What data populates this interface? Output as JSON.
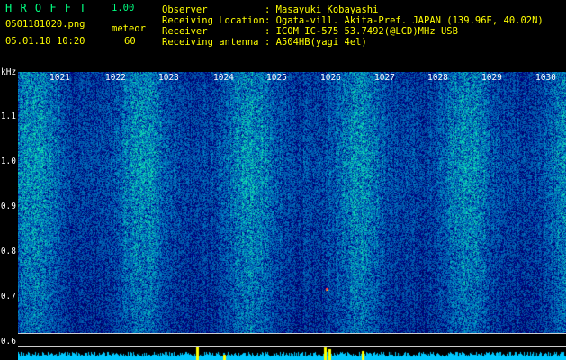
{
  "app": {
    "title_letters": "H R O F F T",
    "version": "1.00",
    "file_name": "0501181020.png",
    "mode": "meteor",
    "datetime": "05.01.18 10:20",
    "count": "60"
  },
  "info": {
    "observer_label": "Observer",
    "observer_value": ": Masayuki Kobayashi",
    "location_label": "Receiving Location",
    "location_value": ": Ogata-vill. Akita-Pref. JAPAN (139.96E, 40.02N)",
    "receiver_label": "Receiver",
    "receiver_value": ": ICOM IC-575 53.7492(@LCD)MHz USB",
    "antenna_label": "Receiving antenna",
    "antenna_value": ": A504HB(yagi 4el)"
  },
  "axis": {
    "unit": "kHz",
    "y_ticks": [
      "1.1",
      "1.0",
      "0.9",
      "0.8",
      "0.7",
      "0.6"
    ],
    "x_ticks": [
      "1021",
      "1022",
      "1023",
      "1024",
      "1025",
      "1026",
      "1027",
      "1028",
      "1029",
      "1030"
    ]
  },
  "colors": {
    "background": "#000000",
    "header_text": "#ffff00",
    "title_text": "#00ff80",
    "spectrum_low": "#000a3a",
    "spectrum_high": "#00ffaa",
    "strip": "#00c8ff",
    "peak": "#ffff00"
  }
}
